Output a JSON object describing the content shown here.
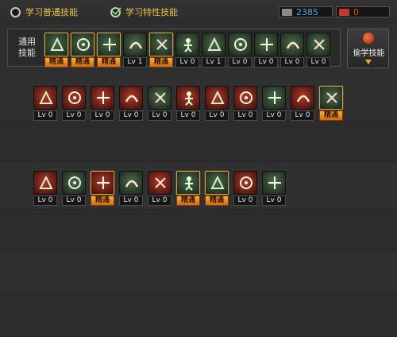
{
  "tabs": {
    "normal_label": "学习普通技能",
    "special_label": "学习特性技能"
  },
  "currency": {
    "blue": "2385",
    "red": "0"
  },
  "common": {
    "label_line1": "通用",
    "label_line2": "技能",
    "skills": [
      {
        "level": "精通",
        "color": "gold",
        "icon": "crouch-figure-icon"
      },
      {
        "level": "精通",
        "color": "gold",
        "icon": "runner-icon"
      },
      {
        "level": "精通",
        "color": "gold",
        "icon": "sprint-icon"
      },
      {
        "level": "Lv 1",
        "color": "green",
        "icon": "wings-icon"
      },
      {
        "level": "精通",
        "color": "gold",
        "icon": "crosshair-icon"
      },
      {
        "level": "Lv 0",
        "color": "green",
        "icon": "target-icon"
      },
      {
        "level": "Lv 1",
        "color": "green",
        "icon": "tree-icon"
      },
      {
        "level": "Lv 0",
        "color": "green",
        "icon": "figure-icon"
      },
      {
        "level": "Lv 0",
        "color": "gold",
        "icon": "eye-icon"
      },
      {
        "level": "Lv 0",
        "color": "green",
        "icon": "power-icon"
      },
      {
        "level": "Lv 0",
        "color": "green",
        "icon": "fighter-icon"
      }
    ]
  },
  "side_button": {
    "label": "偷学技能"
  },
  "row1": [
    {
      "level": "Lv 0",
      "color": "red",
      "icon": "claw-icon"
    },
    {
      "level": "Lv 0",
      "color": "red",
      "icon": "swirl-icon"
    },
    {
      "level": "Lv 0",
      "color": "red",
      "icon": "slash-icon"
    },
    {
      "level": "Lv 0",
      "color": "red",
      "icon": "wings-icon"
    },
    {
      "level": "Lv 0",
      "color": "green",
      "icon": "arrow-icon"
    },
    {
      "level": "Lv 0",
      "color": "red",
      "icon": "shield-icon"
    },
    {
      "level": "Lv 0",
      "color": "red",
      "icon": "flame-icon"
    },
    {
      "level": "Lv 0",
      "color": "red",
      "icon": "sword-icon"
    },
    {
      "level": "Lv 0",
      "color": "green",
      "icon": "spark-icon"
    },
    {
      "level": "Lv 0",
      "color": "red",
      "icon": "burst-icon"
    },
    {
      "level": "精通",
      "color": "green",
      "icon": "wind-icon"
    }
  ],
  "row2": [
    {
      "level": "Lv 0",
      "color": "red",
      "icon": "crescent-icon"
    },
    {
      "level": "Lv 0",
      "color": "green",
      "icon": "kick-icon"
    },
    {
      "level": "精通",
      "color": "red",
      "icon": "heart-icon"
    },
    {
      "level": "Lv 0",
      "color": "green",
      "icon": "strike-icon"
    },
    {
      "level": "Lv 0",
      "color": "red",
      "icon": "axe-icon"
    },
    {
      "level": "精通",
      "color": "green",
      "icon": "dash-icon"
    },
    {
      "level": "精通",
      "color": "green",
      "icon": "explosion-icon"
    },
    {
      "level": "Lv 0",
      "color": "red",
      "icon": "demon-icon"
    },
    {
      "level": "Lv 0",
      "color": "green",
      "icon": "star-icon"
    }
  ],
  "colors": {
    "gold_badge": "#e08a20",
    "accent_text": "#e8c24a",
    "blue_value": "#48a8e8",
    "red_value": "#e84a2a"
  }
}
